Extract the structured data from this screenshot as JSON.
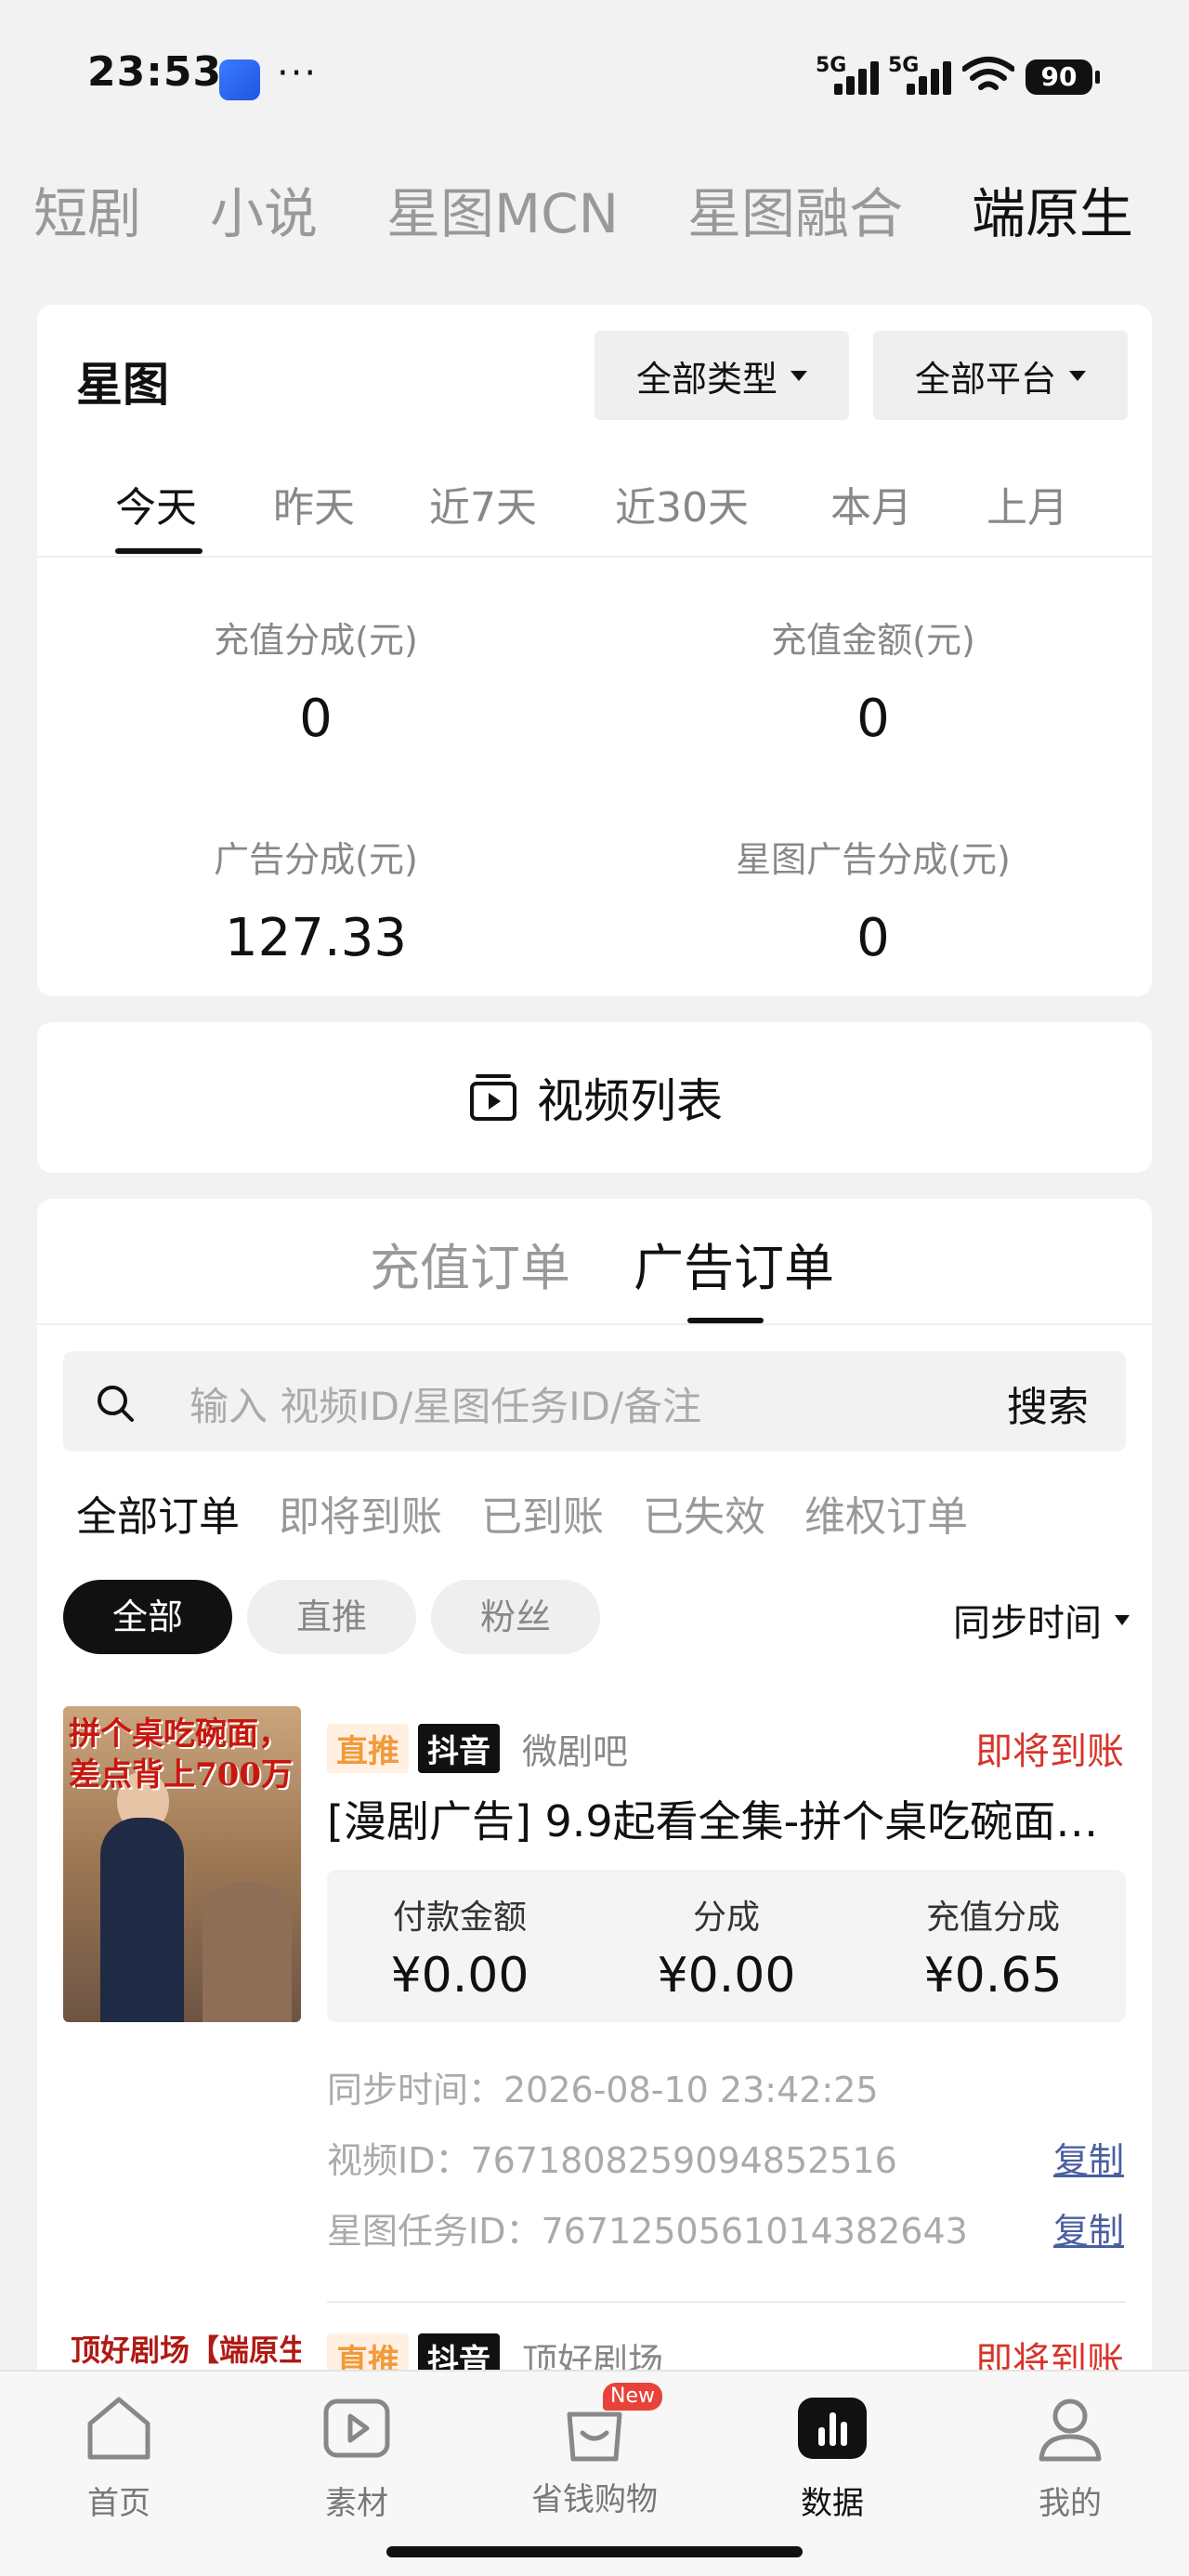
{
  "status_bar": {
    "time": "23:53",
    "dots": "···",
    "signal1": "5G",
    "signal2": "5G",
    "battery": "90"
  },
  "top_tabs": [
    {
      "label": "短剧",
      "active": false
    },
    {
      "label": "小说",
      "active": false
    },
    {
      "label": "星图MCN",
      "active": false
    },
    {
      "label": "星图融合",
      "active": false
    },
    {
      "label": "端原生",
      "active": true
    }
  ],
  "xingtu": {
    "title": "星图",
    "type_filter": "全部类型",
    "platform_filter": "全部平台",
    "date_tabs": [
      "今天",
      "昨天",
      "近7天",
      "近30天",
      "本月",
      "上月"
    ],
    "active_date_tab": "今天",
    "metrics": [
      {
        "label": "充值分成(元)",
        "value": "0"
      },
      {
        "label": "充值金额(元)",
        "value": "0"
      },
      {
        "label": "广告分成(元)",
        "value": "127.33"
      },
      {
        "label": "星图广告分成(元)",
        "value": "0"
      }
    ]
  },
  "video_list": {
    "label": "视频列表"
  },
  "orders": {
    "tabs": [
      "充值订单",
      "广告订单"
    ],
    "active_tab": "广告订单",
    "search_placeholder": "输入 视频ID/星图任务ID/备注",
    "search_button": "搜索",
    "status_filters": [
      "全部订单",
      "即将到账",
      "已到账",
      "已失效",
      "维权订单"
    ],
    "chips": [
      "全部",
      "直推",
      "粉丝"
    ],
    "sort_label": "同步时间",
    "items": [
      {
        "poster_text": "拼个桌吃碗面，差点背上700万",
        "tag_type": "直推",
        "tag_platform": "抖音",
        "source": "微剧吧",
        "status": "即将到账",
        "title": "[漫剧广告] 9.9起看全集-拼个桌吃碗面…",
        "amount_labels": [
          "付款金额",
          "分成",
          "充值分成"
        ],
        "amount_values": [
          "¥0.00",
          "¥0.00",
          "¥0.65"
        ],
        "sync_time": "同步时间：2026-08-10 23:42:25",
        "video_id": "视频ID：7671808259094852516",
        "task_id": "星图任务ID：7671250561014382643",
        "copy_label": "复制"
      },
      {
        "poster_text": "顶好剧场【端原生",
        "tag_type": "直推",
        "tag_platform": "抖音",
        "source": "顶好剧场",
        "status": "即将到账"
      }
    ]
  },
  "bottom_nav": [
    {
      "label": "首页",
      "icon": "home-icon"
    },
    {
      "label": "素材",
      "icon": "play-icon"
    },
    {
      "label": "省钱购物",
      "icon": "shopping-bag-icon",
      "badge": "New"
    },
    {
      "label": "数据",
      "icon": "bar-chart-icon",
      "active": true
    },
    {
      "label": "我的",
      "icon": "user-icon"
    }
  ],
  "colors": {
    "accent_red": "#d6342a",
    "tag_orange": "#f29a3b",
    "link_blue": "#4a5fa0"
  }
}
